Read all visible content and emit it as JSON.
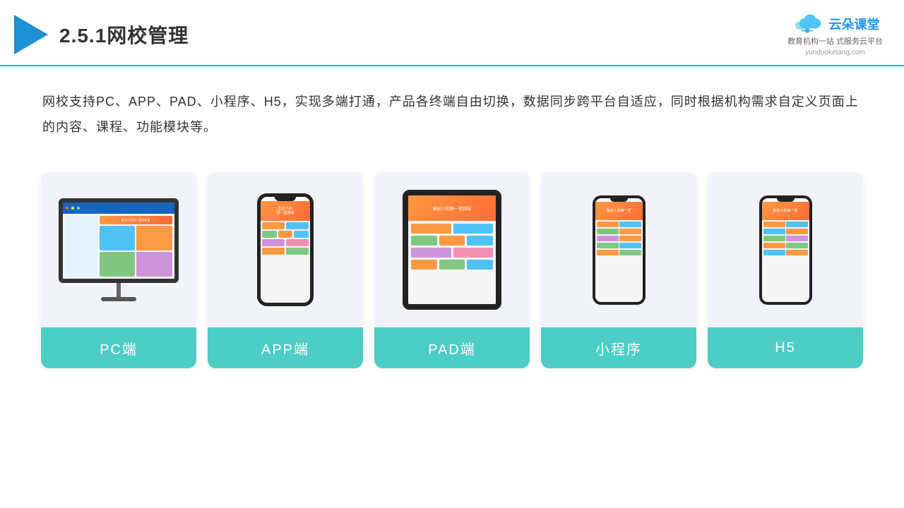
{
  "header": {
    "title": "2.5.1网校管理",
    "brand": {
      "name": "云朵课堂",
      "url": "yunduoketang.com",
      "tagline": "教育机构一站\n式服务云平台"
    }
  },
  "description": {
    "text": "网校支持PC、APP、PAD、小程序、H5，实现多端打通，产品各终端自由切换，数据同步跨平台自适应，同时根据机构需求自定义页面上的内容、课程、功能模块等。"
  },
  "cards": [
    {
      "id": "pc",
      "label": "PC端"
    },
    {
      "id": "app",
      "label": "APP端"
    },
    {
      "id": "pad",
      "label": "PAD端"
    },
    {
      "id": "miniprogram",
      "label": "小程序"
    },
    {
      "id": "h5",
      "label": "H5"
    }
  ],
  "colors": {
    "accent": "#4ecdc4",
    "header_border": "#00bcd4",
    "brand_blue": "#2196f3",
    "text_dark": "#333333"
  }
}
